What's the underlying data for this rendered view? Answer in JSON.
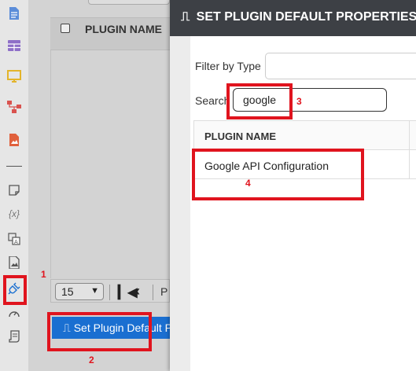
{
  "sidebar": {
    "icons": [
      {
        "name": "document-icon",
        "color": "#5b8dd9"
      },
      {
        "name": "table-icon",
        "color": "#8e6fc7"
      },
      {
        "name": "monitor-icon",
        "color": "#e3b42a"
      },
      {
        "name": "hierarchy-icon",
        "color": "#d9534f"
      },
      {
        "name": "image-icon",
        "color": "#e0603c"
      },
      {
        "name": "note-icon",
        "color": "#555"
      },
      {
        "name": "variable-icon",
        "color": "#777",
        "text": "{x}"
      },
      {
        "name": "translate-icon",
        "color": "#555"
      },
      {
        "name": "picture-icon",
        "color": "#555"
      },
      {
        "name": "plugin-icon",
        "color": "#1a6fd1"
      },
      {
        "name": "gauge-icon",
        "color": "#555"
      },
      {
        "name": "scroll-icon",
        "color": "#555"
      }
    ]
  },
  "background": {
    "column_header": "PLUGIN NAME",
    "page_size": "15",
    "page_label": "P",
    "button_label": "Set Plugin Default P"
  },
  "modal": {
    "title": "SET PLUGIN DEFAULT PROPERTIES",
    "filter_label": "Filter by Type",
    "filter_value": "",
    "search_label": "Search",
    "search_value": "google",
    "columns": [
      "PLUGIN NAME"
    ],
    "rows": [
      [
        "Google API Configuration"
      ]
    ]
  },
  "annotations": {
    "color": "#e0141e",
    "labels": [
      "1",
      "2",
      "3",
      "4"
    ]
  }
}
